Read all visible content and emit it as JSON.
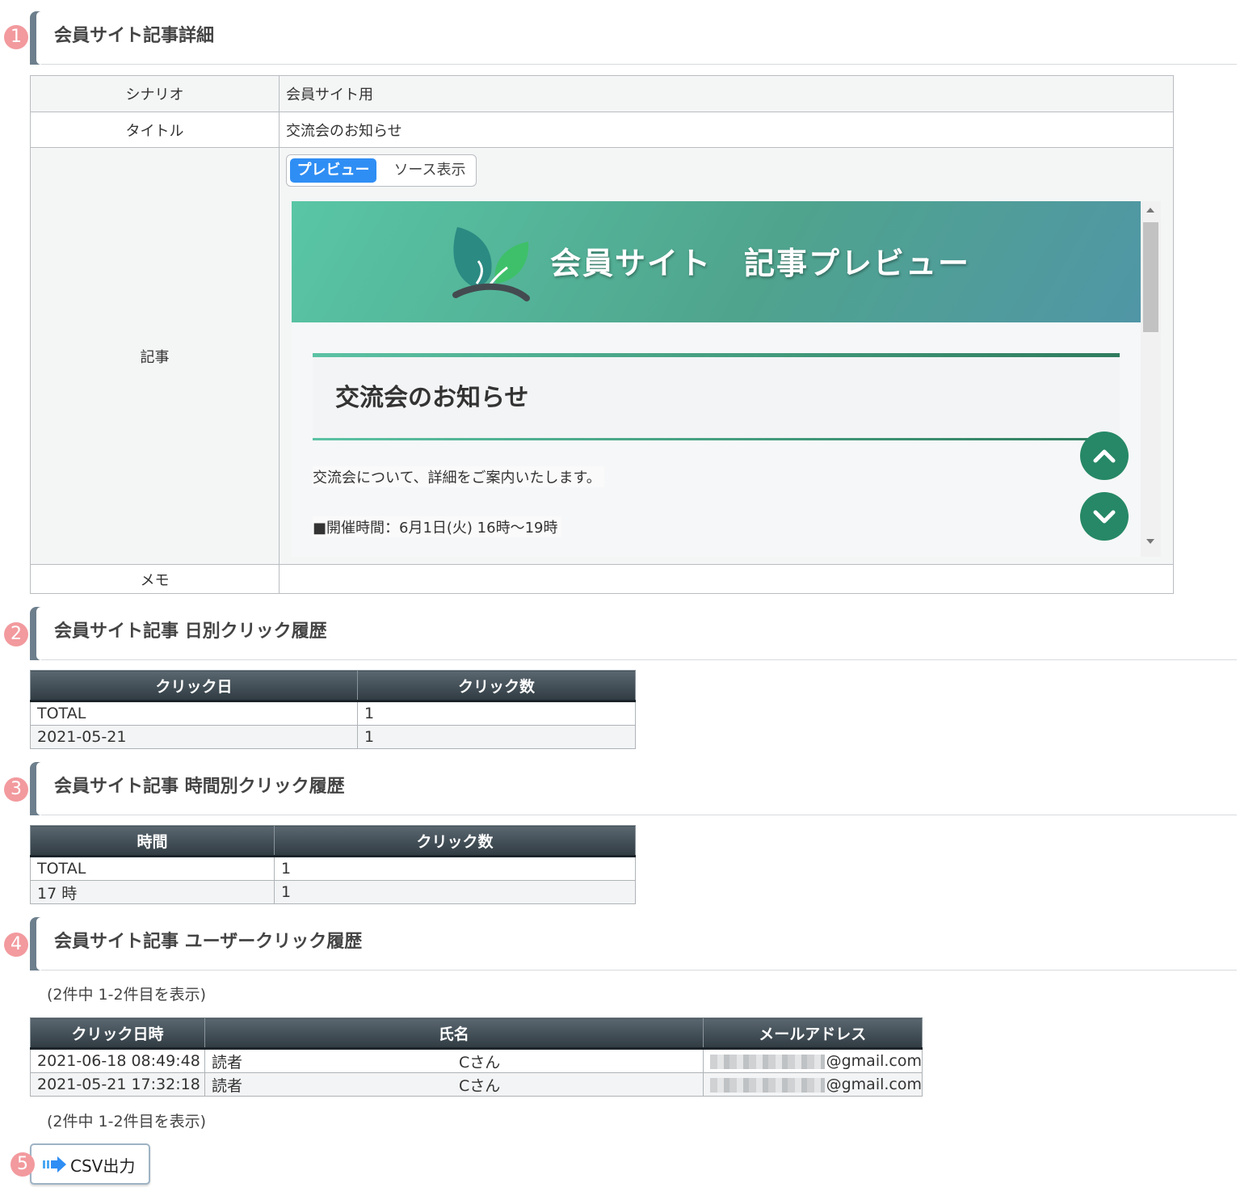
{
  "badges": [
    "1",
    "2",
    "3",
    "4",
    "5"
  ],
  "sections": {
    "detail": "会員サイト記事詳細",
    "daily": "会員サイト記事 日別クリック履歴",
    "hourly": "会員サイト記事 時間別クリック履歴",
    "users": "会員サイト記事 ユーザークリック履歴"
  },
  "detail": {
    "scenario_label": "シナリオ",
    "scenario_value": "会員サイト用",
    "title_label": "タイトル",
    "title_value": "交流会のお知らせ",
    "article_label": "記事",
    "memo_label": "メモ",
    "memo_value": ""
  },
  "tabs": {
    "preview": "プレビュー",
    "source": "ソース表示",
    "active": "preview"
  },
  "preview": {
    "hero_title": "会員サイト　記事プレビュー",
    "article_title": "交流会のお知らせ",
    "paragraph1": "交流会について、詳細をご案内いたします。",
    "paragraph2": "■開催時間：6月1日(火) 16時～19時"
  },
  "daily_table": {
    "headers": [
      "クリック日",
      "クリック数"
    ],
    "rows": [
      [
        "TOTAL",
        "1"
      ],
      [
        "2021-05-21",
        "1"
      ]
    ]
  },
  "hourly_table": {
    "headers": [
      "時間",
      "クリック数"
    ],
    "rows": [
      [
        "TOTAL",
        "1"
      ],
      [
        "17 時",
        "1"
      ]
    ]
  },
  "user_table": {
    "count_note": "(2件中 1-2件目を表示)",
    "headers": [
      "クリック日時",
      "氏名",
      "メールアドレス"
    ],
    "rows": [
      {
        "datetime": "2021-06-18 08:49:48",
        "last": "読者",
        "first": "Cさん",
        "email_domain": "@gmail.com"
      },
      {
        "datetime": "2021-05-21 17:32:18",
        "last": "読者",
        "first": "Cさん",
        "email_domain": "@gmail.com"
      }
    ]
  },
  "csv_button": "CSV出力",
  "colors": {
    "accent": "#2f8ef4",
    "badge": "#f29a9e",
    "hero_green": "#4fa48d",
    "action_green": "#268866"
  }
}
